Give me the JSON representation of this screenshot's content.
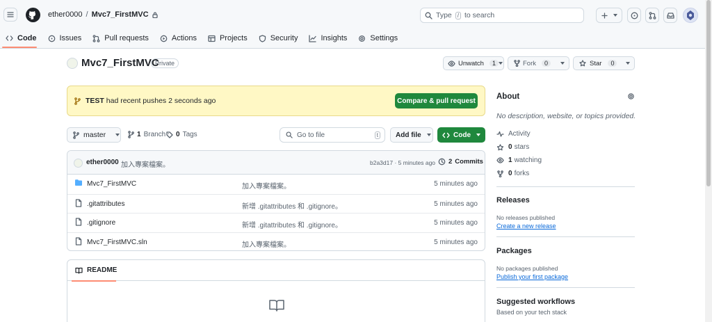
{
  "colors": {
    "accent": "#1f883d",
    "link": "#0969da",
    "tab_underline": "#fd8c73",
    "flash_bg": "#fff8c5"
  },
  "header": {
    "owner": "ether0000",
    "separator": "/",
    "repo": "Mvc7_FirstMVC",
    "search": {
      "prefix": "Type",
      "key": "/",
      "suffix": "to search"
    }
  },
  "tabs": [
    {
      "label": "Code",
      "icon": "code-icon"
    },
    {
      "label": "Issues",
      "icon": "issue-icon"
    },
    {
      "label": "Pull requests",
      "icon": "pull-request-icon"
    },
    {
      "label": "Actions",
      "icon": "play-icon"
    },
    {
      "label": "Projects",
      "icon": "table-icon"
    },
    {
      "label": "Security",
      "icon": "shield-icon"
    },
    {
      "label": "Insights",
      "icon": "graph-icon"
    },
    {
      "label": "Settings",
      "icon": "gear-icon"
    }
  ],
  "repo": {
    "name": "Mvc7_FirstMVC",
    "visibility": "Private",
    "unwatch_label": "Unwatch",
    "watch_count": "1",
    "fork_label": "Fork",
    "fork_count": "0",
    "star_label": "Star",
    "star_count": "0"
  },
  "flash": {
    "branch": "TEST",
    "message": "had recent pushes 2 seconds ago",
    "button": "Compare & pull request"
  },
  "toolbar": {
    "branch": "master",
    "branch_count": "1",
    "branch_label": "Branch",
    "tag_count": "0",
    "tag_label": "Tags",
    "goto_placeholder": "Go to file",
    "goto_key": "t",
    "add_file": "Add file",
    "code": "Code"
  },
  "commit": {
    "author": "ether0000",
    "message": "加入專案檔案。",
    "hash_time": "b2a3d17 · 5 minutes ago",
    "commits_count": "2",
    "commits_label": "Commits"
  },
  "files": [
    {
      "name": "Mvc7_FirstMVC",
      "type": "folder",
      "message": "加入專案檔案。",
      "date": "5 minutes ago"
    },
    {
      "name": ".gitattributes",
      "type": "file",
      "message": "新增 .gitattributes 和 .gitignore。",
      "date": "5 minutes ago"
    },
    {
      "name": ".gitignore",
      "type": "file",
      "message": "新增 .gitattributes 和 .gitignore。",
      "date": "5 minutes ago"
    },
    {
      "name": "Mvc7_FirstMVC.sln",
      "type": "file",
      "message": "加入專案檔案。",
      "date": "5 minutes ago"
    }
  ],
  "readme": {
    "tab": "README"
  },
  "sidebar": {
    "about_title": "About",
    "about_desc": "No description, website, or topics provided.",
    "activity": "Activity",
    "stars_count": "0",
    "stars_label": "stars",
    "watching_count": "1",
    "watching_label": "watching",
    "forks_count": "0",
    "forks_label": "forks",
    "releases_title": "Releases",
    "releases_text": "No releases published",
    "releases_link": "Create a new release",
    "packages_title": "Packages",
    "packages_text": "No packages published",
    "packages_link": "Publish your first package",
    "workflows_title": "Suggested workflows",
    "workflows_text": "Based on your tech stack"
  }
}
